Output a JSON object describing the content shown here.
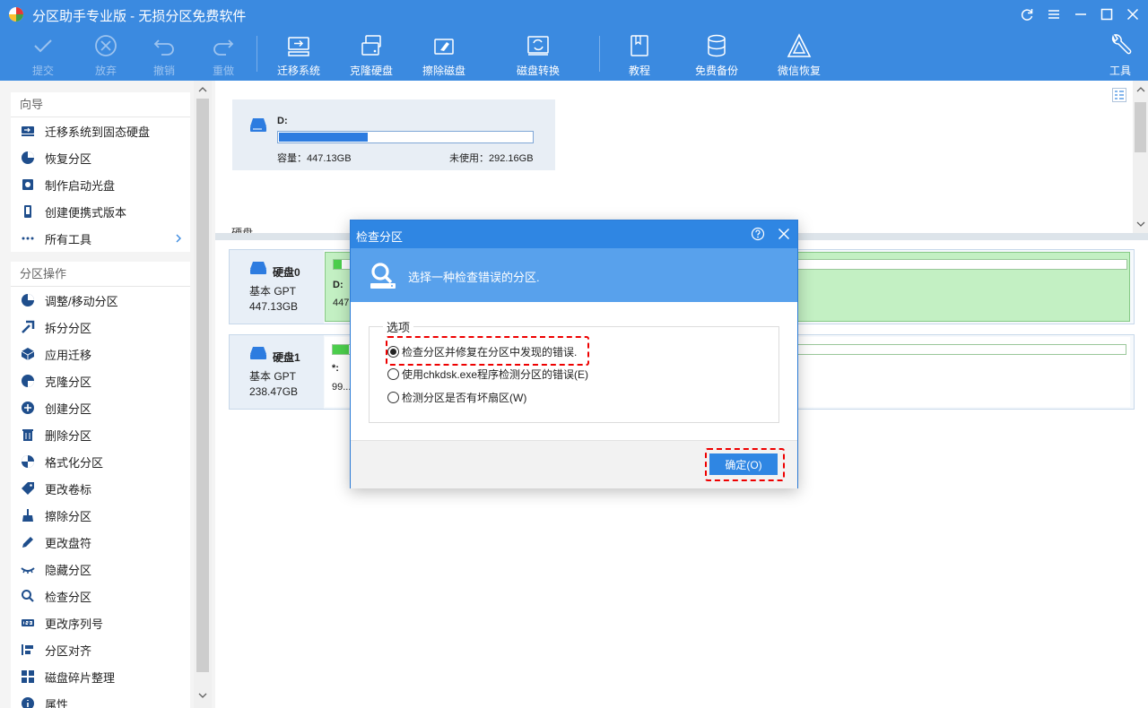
{
  "window": {
    "title": "分区助手专业版 - 无损分区免费软件"
  },
  "toolbar": {
    "commit": "提交",
    "discard": "放弃",
    "undo": "撤销",
    "redo": "重做",
    "migrate_os": "迁移系统",
    "clone_disk": "克隆硬盘",
    "wipe_disk": "擦除磁盘",
    "disk_convert": "磁盘转换",
    "tutorial": "教程",
    "free_backup": "免费备份",
    "wechat_recovery": "微信恢复",
    "tools": "工具"
  },
  "sidebar": {
    "wizard": {
      "heading": "向导",
      "items": [
        {
          "label": "迁移系统到固态硬盘",
          "icon": "migrate-ssd-icon"
        },
        {
          "label": "恢复分区",
          "icon": "restore-partition-icon"
        },
        {
          "label": "制作启动光盘",
          "icon": "bootable-disc-icon"
        },
        {
          "label": "创建便携式版本",
          "icon": "portable-version-icon"
        },
        {
          "label": "所有工具",
          "icon": "all-tools-icon"
        }
      ]
    },
    "operations": {
      "heading": "分区操作",
      "items": [
        {
          "label": "调整/移动分区"
        },
        {
          "label": "拆分分区"
        },
        {
          "label": "应用迁移"
        },
        {
          "label": "克隆分区"
        },
        {
          "label": "创建分区"
        },
        {
          "label": "删除分区"
        },
        {
          "label": "格式化分区"
        },
        {
          "label": "更改卷标"
        },
        {
          "label": "擦除分区"
        },
        {
          "label": "更改盘符"
        },
        {
          "label": "隐藏分区"
        },
        {
          "label": "检查分区"
        },
        {
          "label": "更改序列号"
        },
        {
          "label": "分区对齐"
        },
        {
          "label": "磁盘碎片整理"
        },
        {
          "label": "属性"
        }
      ]
    }
  },
  "partition_card": {
    "name": "D:",
    "capacity": "容量：447.13GB",
    "free": "未使用：292.16GB",
    "used_fraction": 0.35
  },
  "section_label": "硬盘",
  "disks": [
    {
      "name": "硬盘0",
      "type": "基本 GPT",
      "size": "447.13GB",
      "part_label": "D:",
      "part_size": "447...",
      "used_fraction": 0.01,
      "highlight": true
    },
    {
      "name": "硬盘1",
      "type": "基本 GPT",
      "size": "238.47GB",
      "part_label": "*:",
      "part_size": "99...",
      "used_fraction": 0.02,
      "highlight": false
    }
  ],
  "dialog": {
    "title": "检查分区",
    "header_text": "选择一种检查错误的分区.",
    "group_label": "选项",
    "options": [
      {
        "label": "检查分区并修复在分区中发现的错误.",
        "selected": true
      },
      {
        "label": "使用chkdsk.exe程序检测分区的错误(E)",
        "selected": false
      },
      {
        "label": "检测分区是否有坏扇区(W)",
        "selected": false
      }
    ],
    "ok_label": "确定(O)"
  },
  "colors": {
    "accent": "#3b8ae0",
    "dialog_header": "#58a1ec",
    "usage_green": "#4ccf4c",
    "usage_blue": "#2d7ce0",
    "highlight_box": "#ee0000"
  }
}
